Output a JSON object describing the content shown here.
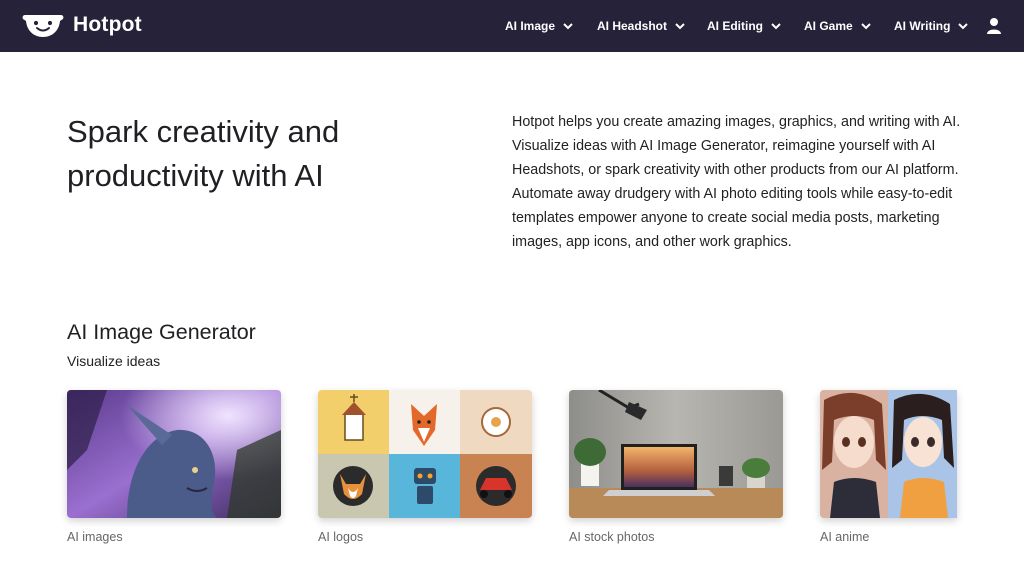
{
  "header": {
    "brand": "Hotpot",
    "nav": [
      {
        "label": "AI Image"
      },
      {
        "label": "AI Headshot"
      },
      {
        "label": "AI Editing"
      },
      {
        "label": "AI Game"
      },
      {
        "label": "AI Writing"
      }
    ],
    "icons": {
      "logo": "smiling-pot-logo",
      "user": "user-icon",
      "chevron": "chevron-down-icon"
    }
  },
  "hero": {
    "title": "Spark creativity and productivity with AI",
    "description": "Hotpot helps you create amazing images, graphics, and writing with AI. Visualize ideas with AI Image Generator, reimagine yourself with AI Headshots, or spark creativity with other products from our AI platform. Automate away drudgery with AI photo editing tools while easy-to-edit templates empower anyone to create social media posts, marketing images, app icons, and other work graphics."
  },
  "section": {
    "title": "AI Image Generator",
    "subtitle": "Visualize ideas",
    "cards": [
      {
        "label": "AI images"
      },
      {
        "label": "AI logos"
      },
      {
        "label": "AI stock photos"
      },
      {
        "label": "AI anime"
      }
    ]
  },
  "colors": {
    "header_bg": "#25223a",
    "text": "#1f1f24",
    "caption": "#666666"
  }
}
